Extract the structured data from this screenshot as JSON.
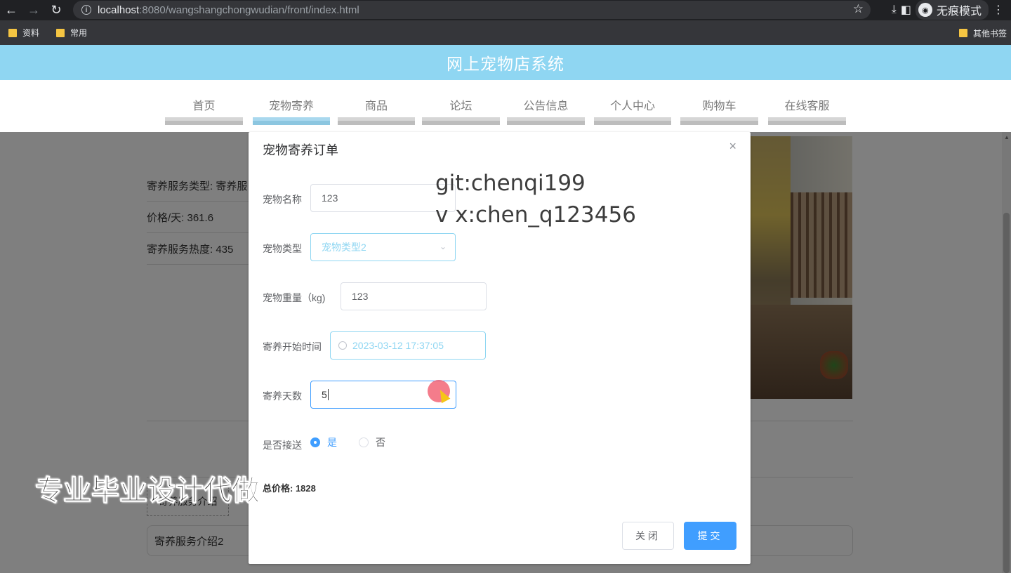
{
  "browser": {
    "url_host": "localhost",
    "url_path": ":8080/wangshangchongwudian/front/index.html",
    "incognito_label": "无痕模式",
    "bookmarks": [
      "资料",
      "常用"
    ],
    "other_bookmarks": "其他书签"
  },
  "site": {
    "title": "网上宠物店系统",
    "nav": [
      "首页",
      "宠物寄养",
      "商品",
      "论坛",
      "公告信息",
      "个人中心",
      "购物车",
      "在线客服"
    ],
    "active_nav": "宠物寄养"
  },
  "detail": {
    "service_type": "寄养服务类型: 寄养服",
    "price": "价格/天: 361.6",
    "heat": "寄养服务热度: 435",
    "tab": "寄养服务介绍",
    "intro": "寄养服务介绍2"
  },
  "dialog": {
    "title": "宠物寄养订单",
    "fields": {
      "pet_name_label": "宠物名称",
      "pet_name_value": "123",
      "pet_type_label": "宠物类型",
      "pet_type_value": "宠物类型2",
      "pet_weight_label": "宠物重量（kg)",
      "pet_weight_value": "123",
      "start_time_label": "寄养开始时间",
      "start_time_value": "2023-03-12 17:37:05",
      "days_label": "寄养天数",
      "days_value": "5",
      "pickup_label": "是否接送",
      "pickup_yes": "是",
      "pickup_no": "否"
    },
    "total": "总价格: 1828",
    "close_button": "关闭",
    "submit_button": "提交"
  },
  "watermark": {
    "line1": "git:chenqi199",
    "line2": "v x:chen_q123456"
  },
  "ad_text": "专业毕业设计代做",
  "colors": {
    "header_bg": "#8fd6f2",
    "primary": "#409eff"
  }
}
